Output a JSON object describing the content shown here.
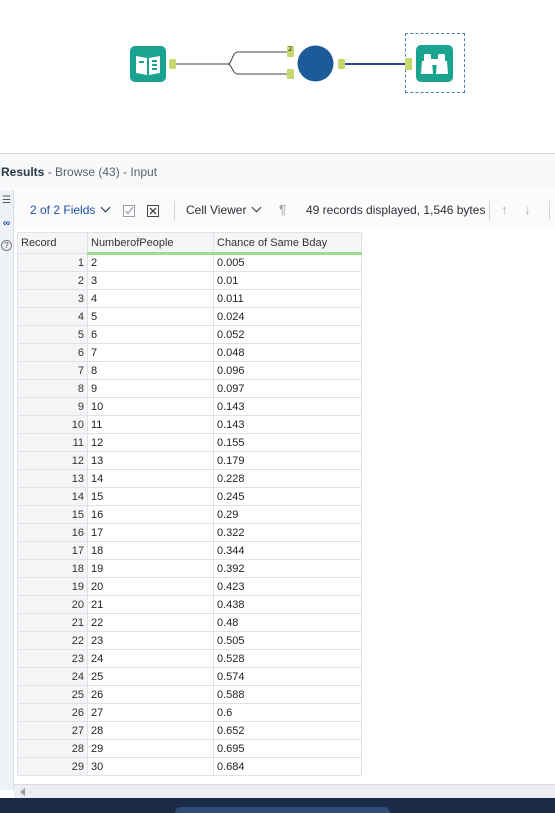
{
  "results": {
    "title": "Results",
    "subtitle": " - Browse (43) - Input"
  },
  "toolbar": {
    "fields_label": "2 of 2 Fields",
    "viewer_label": "Cell Viewer",
    "records_info": "49 records displayed, 1,546 bytes"
  },
  "canvas": {
    "connector_label": "2"
  },
  "table": {
    "columns": [
      "Record",
      "NumberofPeople",
      "Chance of Same Bday"
    ],
    "rows": [
      [
        "1",
        "2",
        "0.005"
      ],
      [
        "2",
        "3",
        "0.01"
      ],
      [
        "3",
        "4",
        "0.011"
      ],
      [
        "4",
        "5",
        "0.024"
      ],
      [
        "5",
        "6",
        "0.052"
      ],
      [
        "6",
        "7",
        "0.048"
      ],
      [
        "7",
        "8",
        "0.096"
      ],
      [
        "8",
        "9",
        "0.097"
      ],
      [
        "9",
        "10",
        "0.143"
      ],
      [
        "10",
        "11",
        "0.143"
      ],
      [
        "11",
        "12",
        "0.155"
      ],
      [
        "12",
        "13",
        "0.179"
      ],
      [
        "13",
        "14",
        "0.228"
      ],
      [
        "14",
        "15",
        "0.245"
      ],
      [
        "15",
        "16",
        "0.29"
      ],
      [
        "16",
        "17",
        "0.322"
      ],
      [
        "17",
        "18",
        "0.344"
      ],
      [
        "18",
        "19",
        "0.392"
      ],
      [
        "19",
        "20",
        "0.423"
      ],
      [
        "20",
        "21",
        "0.438"
      ],
      [
        "21",
        "22",
        "0.48"
      ],
      [
        "22",
        "23",
        "0.505"
      ],
      [
        "23",
        "24",
        "0.528"
      ],
      [
        "24",
        "25",
        "0.574"
      ],
      [
        "25",
        "26",
        "0.588"
      ],
      [
        "26",
        "27",
        "0.6"
      ],
      [
        "27",
        "28",
        "0.652"
      ],
      [
        "28",
        "29",
        "0.695"
      ],
      [
        "29",
        "30",
        "0.684"
      ]
    ]
  },
  "colors": {
    "tool_teal": "#1aa38f",
    "formula_blue": "#1d5a9a",
    "anchor_green": "#c5d86d",
    "accent_blue": "#1f4fa8"
  },
  "icons": {
    "input_tool": "book-icon",
    "formula_tool": "circle-tool-icon",
    "browse_tool": "binoculars-icon"
  }
}
